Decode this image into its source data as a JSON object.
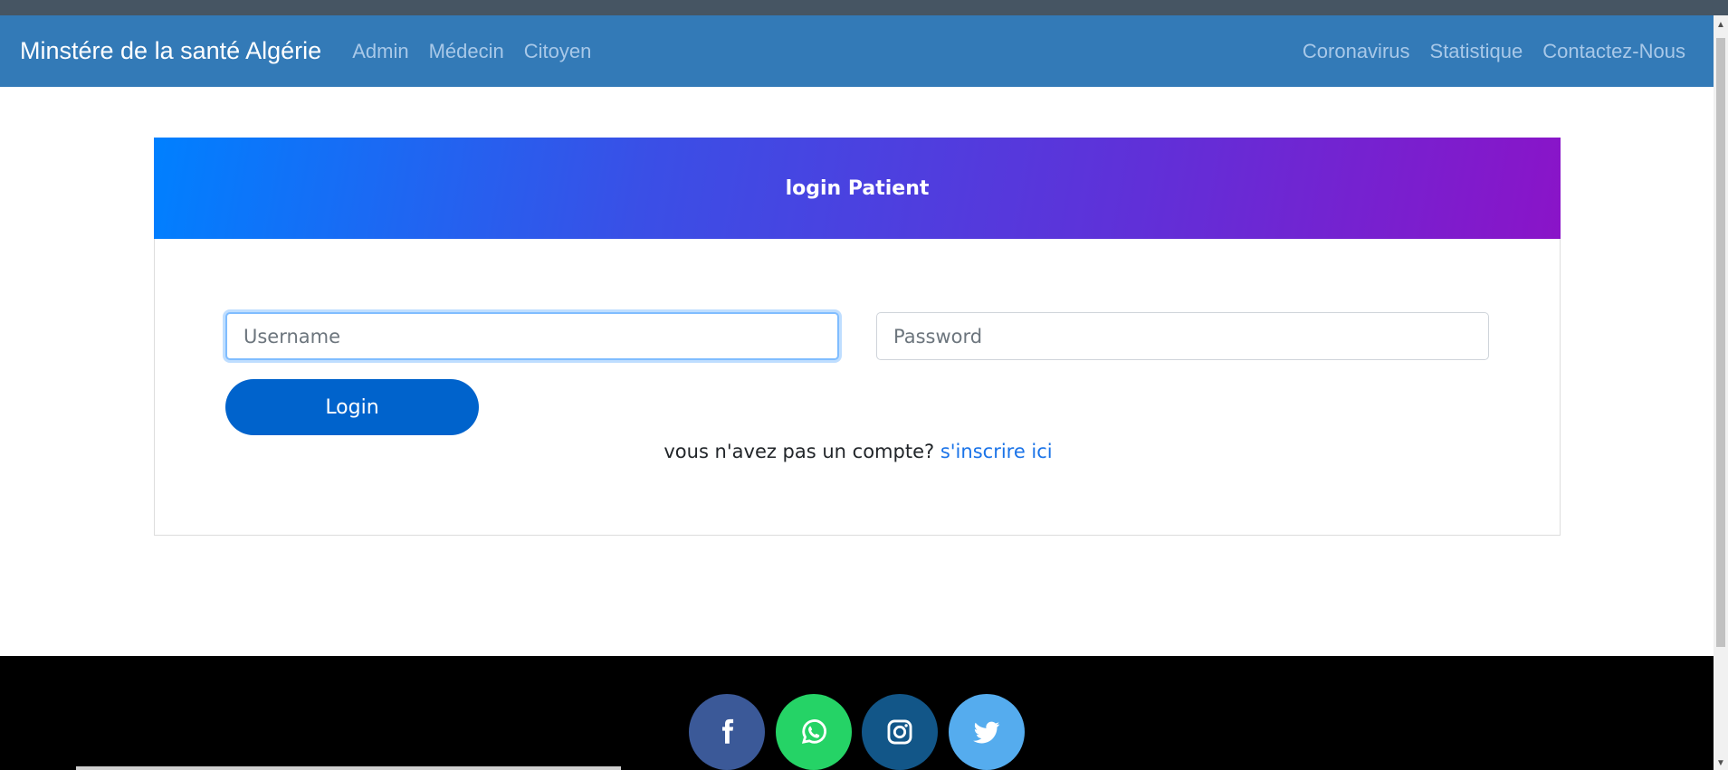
{
  "navbar": {
    "brand": "Minstére de la santé Algérie",
    "left_links": [
      "Admin",
      "Médecin",
      "Citoyen"
    ],
    "right_links": [
      "Coronavirus",
      "Statistique",
      "Contactez-Nous"
    ],
    "background_color": "#337ab7"
  },
  "login_card": {
    "title": "login Patient",
    "username_placeholder": "Username",
    "password_placeholder": "Password",
    "login_label": "Login",
    "signup_prompt": "vous n'avez pas un compte?",
    "signup_link": "s'inscrire ici"
  },
  "footer": {
    "social_icons": [
      "facebook-icon",
      "whatsapp-icon",
      "instagram-icon",
      "twitter-icon"
    ]
  }
}
